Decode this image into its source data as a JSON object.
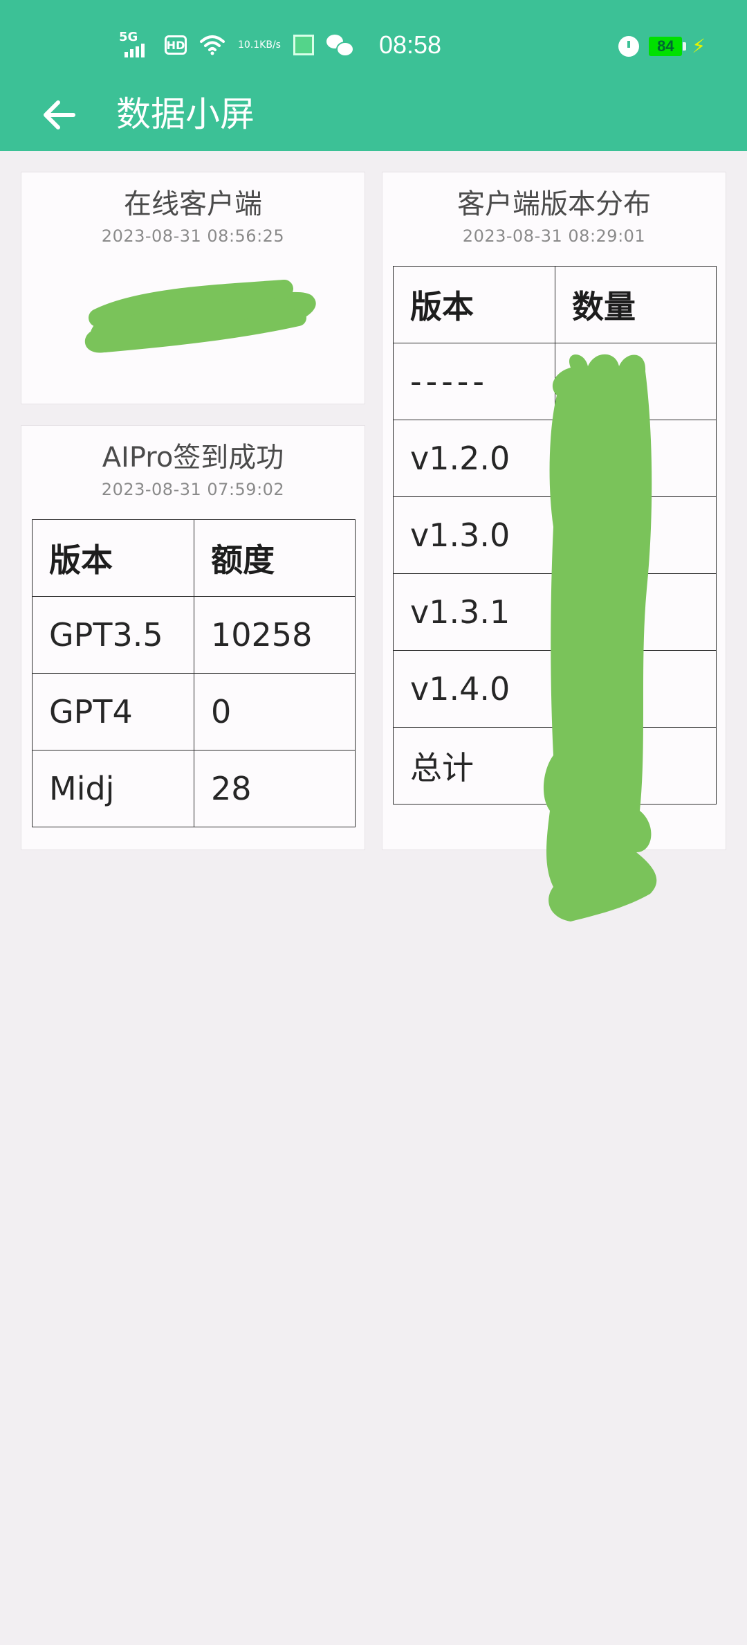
{
  "status_bar": {
    "network_type": "5G",
    "hd_label": "HD",
    "speed_value": "10.1",
    "speed_unit": "KB/s",
    "time": "08:58",
    "battery_level": "84",
    "icons": [
      "signal-icon",
      "hd-icon",
      "wifi-icon",
      "app-notification-icon",
      "wechat-icon",
      "alarm-icon",
      "battery-icon",
      "charging-icon"
    ]
  },
  "app_bar": {
    "title": "数据小屏",
    "back_icon": "arrow-left-icon",
    "background_color": "#3cc196"
  },
  "online_clients_card": {
    "title": "在线客户端",
    "timestamp": "2023-08-31 08:56:25",
    "value_redacted": true
  },
  "aipro_signin_card": {
    "title": "AIPro签到成功",
    "timestamp": "2023-08-31 07:59:02",
    "table": {
      "headers": [
        "版本",
        "额度"
      ],
      "rows": [
        [
          "GPT3.5",
          "10258"
        ],
        [
          "GPT4",
          "0"
        ],
        [
          "Midj",
          "28"
        ]
      ]
    }
  },
  "client_version_card": {
    "title": "客户端版本分布",
    "timestamp": "2023-08-31 08:29:01",
    "table": {
      "headers": [
        "版本",
        "数量"
      ],
      "rows": [
        [
          "-----",
          ""
        ],
        [
          "v1.2.0",
          ""
        ],
        [
          "v1.3.0",
          ""
        ],
        [
          "v1.3.1",
          ""
        ],
        [
          "v1.4.0",
          ""
        ],
        [
          "总计",
          ""
        ]
      ],
      "count_column_redacted": true
    }
  },
  "colors": {
    "accent": "#3cc196",
    "redaction": "#7ac35a",
    "page_background": "#f2eff2"
  }
}
